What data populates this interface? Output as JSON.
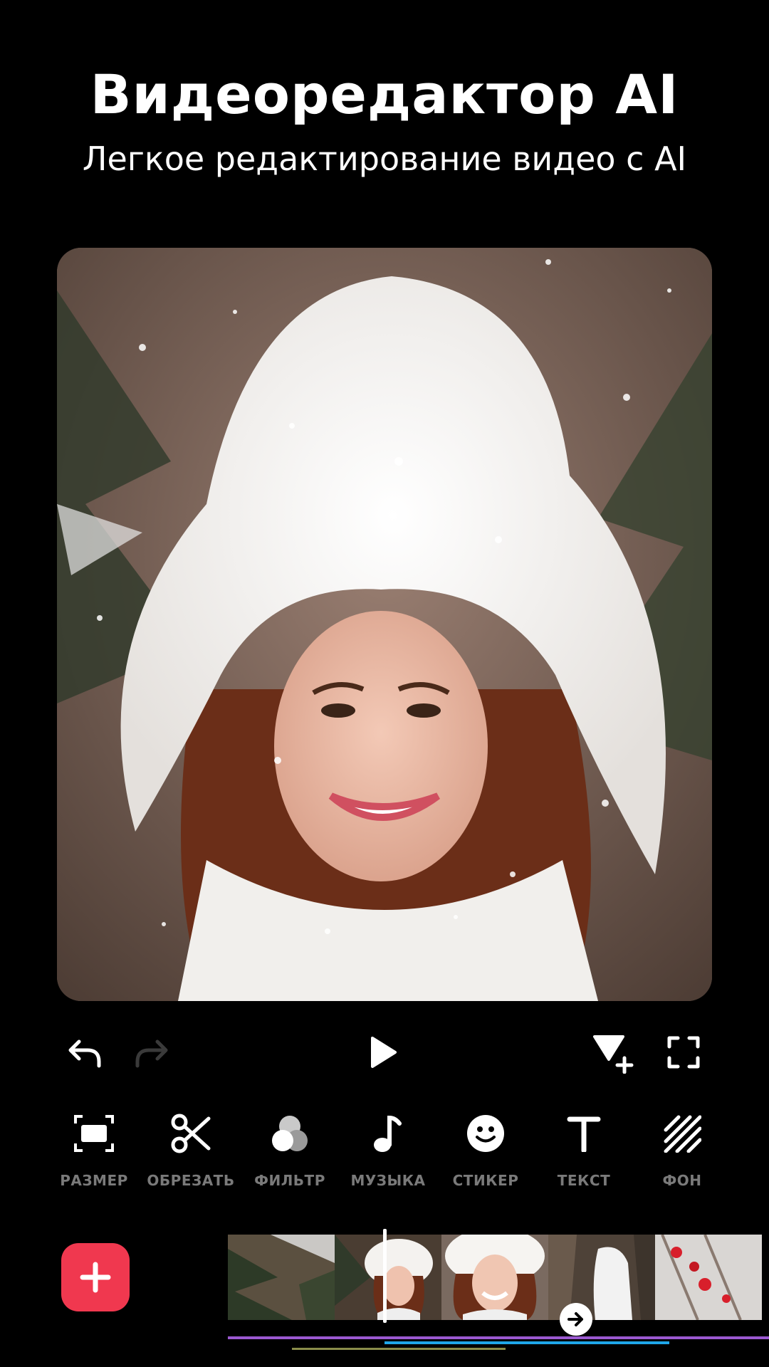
{
  "header": {
    "title": "Видеоредактор AI",
    "subtitle": "Легкое редактирование видео с AI"
  },
  "controls": {
    "undo_icon": "undo-icon",
    "redo_icon": "redo-icon",
    "play_icon": "play-icon",
    "add_keyframe_icon": "keyframe-add-icon",
    "fullscreen_icon": "fullscreen-icon"
  },
  "tools": [
    {
      "label": "РАЗМЕР",
      "icon": "resize-icon"
    },
    {
      "label": "ОБРЕЗАТЬ",
      "icon": "scissors-icon"
    },
    {
      "label": "ФИЛЬТР",
      "icon": "filter-icon"
    },
    {
      "label": "МУЗЫКА",
      "icon": "music-note-icon"
    },
    {
      "label": "СТИКЕР",
      "icon": "smiley-icon"
    },
    {
      "label": "ТЕКСТ",
      "icon": "text-icon"
    },
    {
      "label": "ФОН",
      "icon": "background-icon"
    }
  ],
  "timeline": {
    "add_icon": "plus-icon",
    "next_icon": "arrow-right-icon"
  },
  "colors": {
    "accent": "#f0384f",
    "background": "#000000",
    "tool_label": "#7a7a7a",
    "track_purple": "#9b59d0",
    "track_blue": "#1fa6e8"
  }
}
